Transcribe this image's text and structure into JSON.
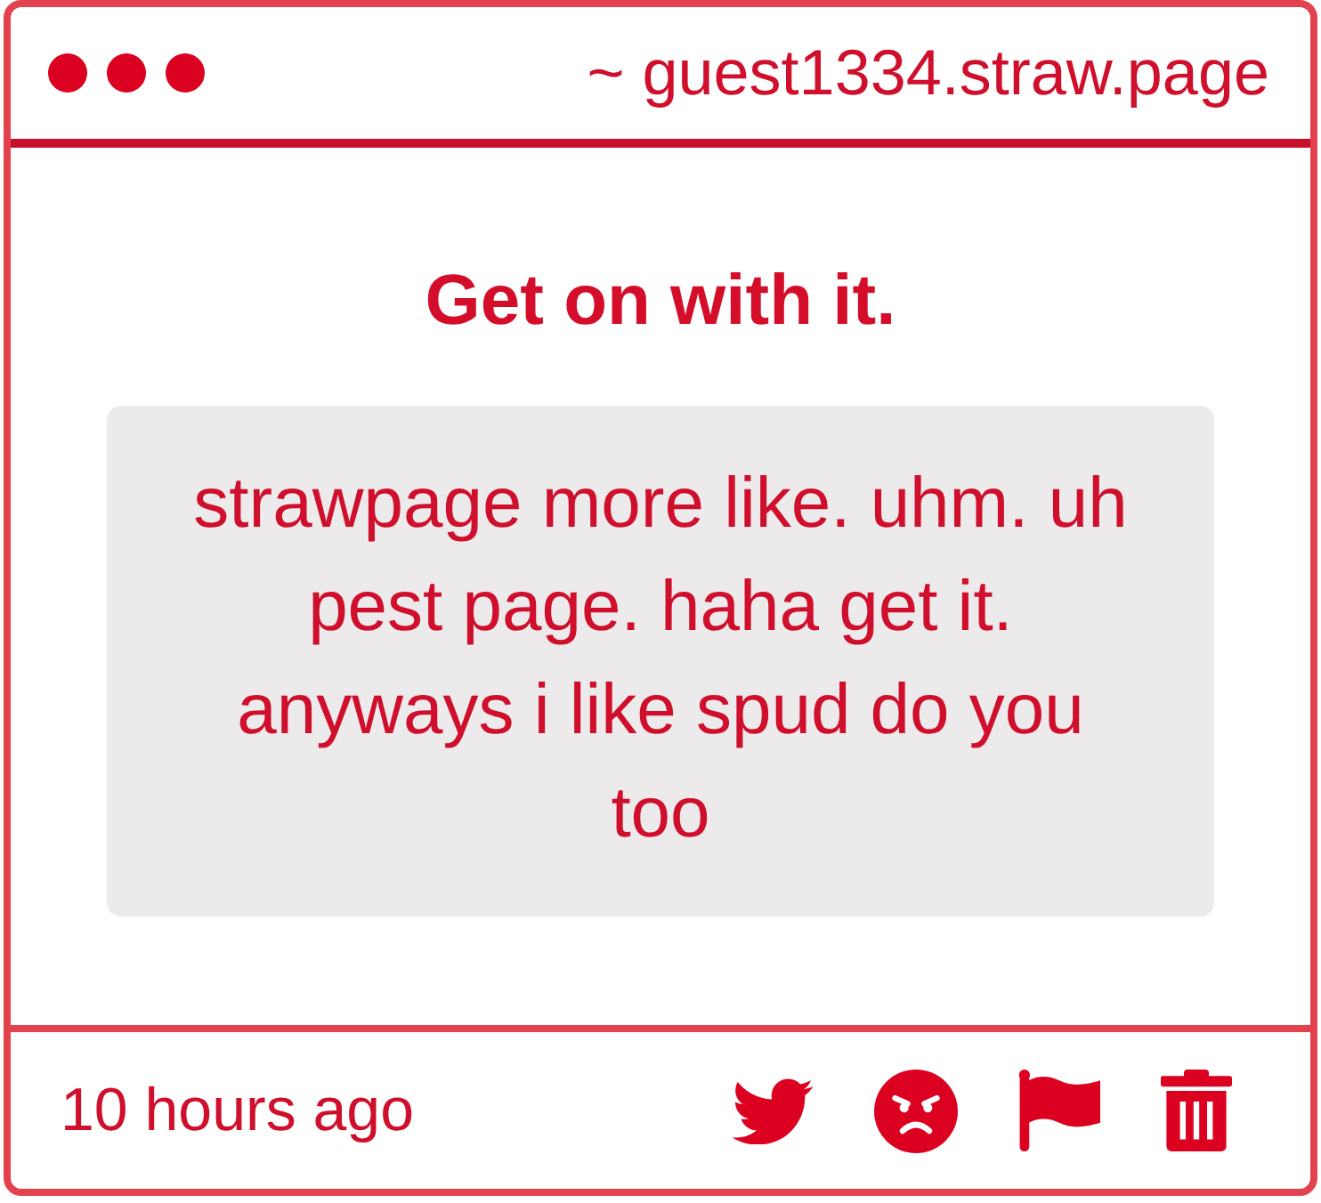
{
  "header": {
    "url": "~ guest1334.straw.page"
  },
  "message": {
    "title": "Get on with it.",
    "body": "strawpage more like. uhm. uh pest page. haha get it. anyways i like spud do you too"
  },
  "footer": {
    "time": "10 hours ago",
    "actions": [
      {
        "kind": "bird"
      },
      {
        "kind": "angry"
      },
      {
        "kind": "flag"
      },
      {
        "kind": "trash"
      }
    ]
  }
}
